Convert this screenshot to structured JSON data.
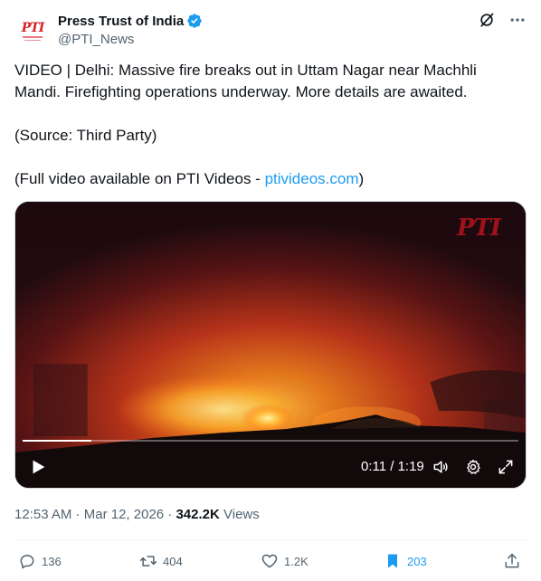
{
  "author": {
    "display_name": "Press Trust of India",
    "handle": "@PTI_News",
    "avatar_text": "PTI"
  },
  "tweet": {
    "line1": "VIDEO | Delhi: Massive fire breaks out in Uttam Nagar near Machhli Mandi. Firefighting operations underway. More details are awaited.",
    "line2": "(Source: Third Party)",
    "line3_prefix": "(Full video available on PTI Videos - ",
    "line3_link": "ptivideos.com",
    "line3_suffix": ")"
  },
  "video": {
    "watermark": "PTI",
    "time_display": "0:11 / 1:19",
    "progress_fraction": 0.139
  },
  "meta": {
    "time": "12:53 AM",
    "sep1": " · ",
    "date": "Mar 12, 2026",
    "sep2": " · ",
    "views_count": "342.2K",
    "views_label": " Views"
  },
  "actions": {
    "replies": "136",
    "reposts": "404",
    "likes": "1.2K",
    "bookmarks": "203"
  },
  "colors": {
    "accent": "#1d9bf0",
    "brand_red": "#d3222a",
    "secondary_text": "#536471"
  },
  "icons": [
    "verified-badge-icon",
    "grok-icon",
    "more-icon",
    "play-icon",
    "volume-icon",
    "settings-icon",
    "fullscreen-icon",
    "reply-icon",
    "repost-icon",
    "like-icon",
    "bookmark-icon",
    "share-icon"
  ]
}
